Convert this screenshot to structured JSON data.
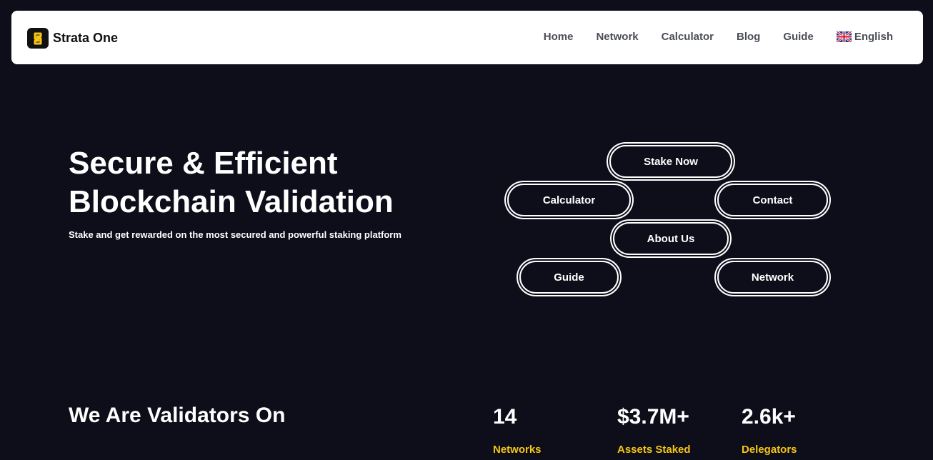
{
  "brand": {
    "name": "Strata One",
    "logo_icon": "strata-s-logo-icon",
    "accent": "#f5c518"
  },
  "nav": {
    "links": [
      "Home",
      "Network",
      "Calculator",
      "Blog",
      "Guide"
    ],
    "language": {
      "label": "English",
      "flag_icon": "uk-flag-icon"
    }
  },
  "hero": {
    "title_line1": "Secure & Efficient",
    "title_line2": "Blockchain Validation",
    "subtitle": "Stake and get rewarded on the most secured and powerful staking platform"
  },
  "actions": {
    "stake_now": "Stake Now",
    "calculator": "Calculator",
    "contact": "Contact",
    "about_us": "About Us",
    "guide": "Guide",
    "network": "Network"
  },
  "validators": {
    "heading": "We Are Validators On",
    "stats": [
      {
        "value": "14",
        "label": "Networks"
      },
      {
        "value": "$3.7M+",
        "label": "Assets Staked"
      },
      {
        "value": "2.6k+",
        "label": "Delegators"
      }
    ]
  },
  "colors": {
    "background": "#0d0e1a",
    "navbar": "#ffffff",
    "stat_label": "#f5c518"
  }
}
